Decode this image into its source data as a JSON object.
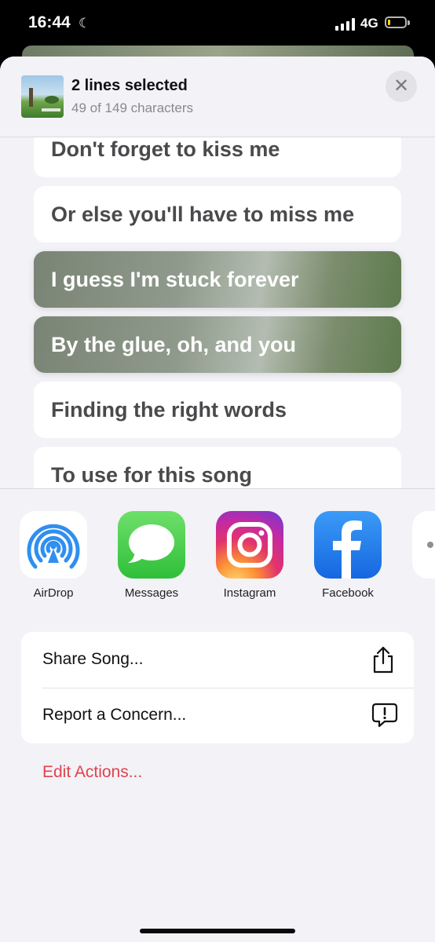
{
  "status_bar": {
    "time": "16:44",
    "network": "4G",
    "battery_level": 0.1
  },
  "header": {
    "title": "2 lines selected",
    "subtitle": "49 of 149 characters",
    "close_icon": "close-icon"
  },
  "lyrics": [
    {
      "text": "Don't forget to kiss me",
      "selected": false
    },
    {
      "text": "Or else you'll have to miss me",
      "selected": false
    },
    {
      "text": "I guess I'm stuck forever",
      "selected": true
    },
    {
      "text": "By the glue, oh, and you",
      "selected": true
    },
    {
      "text": "Finding the right words",
      "selected": false
    },
    {
      "text": "To use for this song",
      "selected": false
    }
  ],
  "share_targets": [
    {
      "label": "AirDrop",
      "icon": "airdrop-icon"
    },
    {
      "label": "Messages",
      "icon": "messages-icon"
    },
    {
      "label": "Instagram",
      "icon": "instagram-icon"
    },
    {
      "label": "Facebook",
      "icon": "facebook-icon"
    },
    {
      "label": "",
      "icon": "more-icon"
    }
  ],
  "actions": [
    {
      "label": "Share Song...",
      "icon": "share-icon"
    },
    {
      "label": "Report a Concern...",
      "icon": "report-icon"
    }
  ],
  "edit_actions": "Edit Actions...",
  "colors": {
    "accent_red": "#e0434c",
    "sheet_bg": "#f2f2f7"
  }
}
